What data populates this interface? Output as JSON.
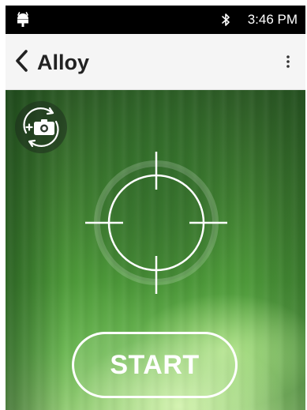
{
  "status_bar": {
    "time": "3:46 PM",
    "left_icon": "android-icon",
    "bluetooth_icon": "bluetooth-icon"
  },
  "app_bar": {
    "title": "Alloy",
    "back_icon": "chevron-left-icon",
    "more_icon": "more-vertical-icon"
  },
  "camera": {
    "switch_icon": "switch-camera-icon",
    "reticle_icon": "crosshair-icon"
  },
  "actions": {
    "start_label": "START"
  }
}
